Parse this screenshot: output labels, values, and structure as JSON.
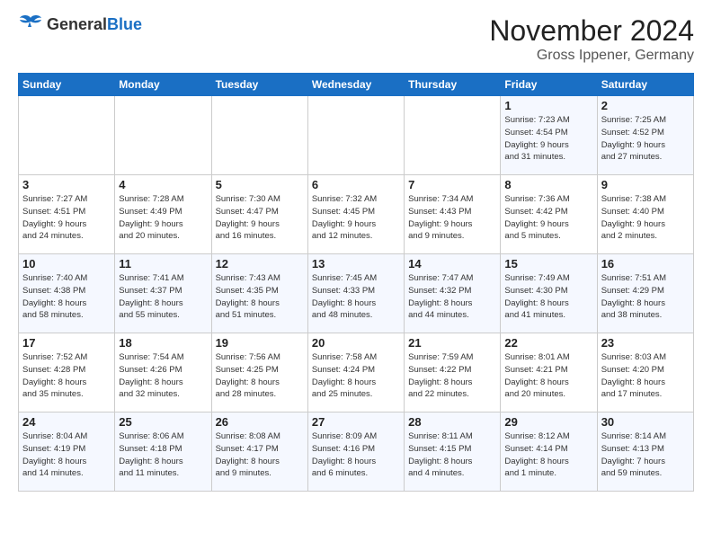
{
  "header": {
    "logo_general": "General",
    "logo_blue": "Blue",
    "month": "November 2024",
    "location": "Gross Ippener, Germany"
  },
  "weekdays": [
    "Sunday",
    "Monday",
    "Tuesday",
    "Wednesday",
    "Thursday",
    "Friday",
    "Saturday"
  ],
  "weeks": [
    [
      {
        "day": "",
        "info": ""
      },
      {
        "day": "",
        "info": ""
      },
      {
        "day": "",
        "info": ""
      },
      {
        "day": "",
        "info": ""
      },
      {
        "day": "",
        "info": ""
      },
      {
        "day": "1",
        "info": "Sunrise: 7:23 AM\nSunset: 4:54 PM\nDaylight: 9 hours\nand 31 minutes."
      },
      {
        "day": "2",
        "info": "Sunrise: 7:25 AM\nSunset: 4:52 PM\nDaylight: 9 hours\nand 27 minutes."
      }
    ],
    [
      {
        "day": "3",
        "info": "Sunrise: 7:27 AM\nSunset: 4:51 PM\nDaylight: 9 hours\nand 24 minutes."
      },
      {
        "day": "4",
        "info": "Sunrise: 7:28 AM\nSunset: 4:49 PM\nDaylight: 9 hours\nand 20 minutes."
      },
      {
        "day": "5",
        "info": "Sunrise: 7:30 AM\nSunset: 4:47 PM\nDaylight: 9 hours\nand 16 minutes."
      },
      {
        "day": "6",
        "info": "Sunrise: 7:32 AM\nSunset: 4:45 PM\nDaylight: 9 hours\nand 12 minutes."
      },
      {
        "day": "7",
        "info": "Sunrise: 7:34 AM\nSunset: 4:43 PM\nDaylight: 9 hours\nand 9 minutes."
      },
      {
        "day": "8",
        "info": "Sunrise: 7:36 AM\nSunset: 4:42 PM\nDaylight: 9 hours\nand 5 minutes."
      },
      {
        "day": "9",
        "info": "Sunrise: 7:38 AM\nSunset: 4:40 PM\nDaylight: 9 hours\nand 2 minutes."
      }
    ],
    [
      {
        "day": "10",
        "info": "Sunrise: 7:40 AM\nSunset: 4:38 PM\nDaylight: 8 hours\nand 58 minutes."
      },
      {
        "day": "11",
        "info": "Sunrise: 7:41 AM\nSunset: 4:37 PM\nDaylight: 8 hours\nand 55 minutes."
      },
      {
        "day": "12",
        "info": "Sunrise: 7:43 AM\nSunset: 4:35 PM\nDaylight: 8 hours\nand 51 minutes."
      },
      {
        "day": "13",
        "info": "Sunrise: 7:45 AM\nSunset: 4:33 PM\nDaylight: 8 hours\nand 48 minutes."
      },
      {
        "day": "14",
        "info": "Sunrise: 7:47 AM\nSunset: 4:32 PM\nDaylight: 8 hours\nand 44 minutes."
      },
      {
        "day": "15",
        "info": "Sunrise: 7:49 AM\nSunset: 4:30 PM\nDaylight: 8 hours\nand 41 minutes."
      },
      {
        "day": "16",
        "info": "Sunrise: 7:51 AM\nSunset: 4:29 PM\nDaylight: 8 hours\nand 38 minutes."
      }
    ],
    [
      {
        "day": "17",
        "info": "Sunrise: 7:52 AM\nSunset: 4:28 PM\nDaylight: 8 hours\nand 35 minutes."
      },
      {
        "day": "18",
        "info": "Sunrise: 7:54 AM\nSunset: 4:26 PM\nDaylight: 8 hours\nand 32 minutes."
      },
      {
        "day": "19",
        "info": "Sunrise: 7:56 AM\nSunset: 4:25 PM\nDaylight: 8 hours\nand 28 minutes."
      },
      {
        "day": "20",
        "info": "Sunrise: 7:58 AM\nSunset: 4:24 PM\nDaylight: 8 hours\nand 25 minutes."
      },
      {
        "day": "21",
        "info": "Sunrise: 7:59 AM\nSunset: 4:22 PM\nDaylight: 8 hours\nand 22 minutes."
      },
      {
        "day": "22",
        "info": "Sunrise: 8:01 AM\nSunset: 4:21 PM\nDaylight: 8 hours\nand 20 minutes."
      },
      {
        "day": "23",
        "info": "Sunrise: 8:03 AM\nSunset: 4:20 PM\nDaylight: 8 hours\nand 17 minutes."
      }
    ],
    [
      {
        "day": "24",
        "info": "Sunrise: 8:04 AM\nSunset: 4:19 PM\nDaylight: 8 hours\nand 14 minutes."
      },
      {
        "day": "25",
        "info": "Sunrise: 8:06 AM\nSunset: 4:18 PM\nDaylight: 8 hours\nand 11 minutes."
      },
      {
        "day": "26",
        "info": "Sunrise: 8:08 AM\nSunset: 4:17 PM\nDaylight: 8 hours\nand 9 minutes."
      },
      {
        "day": "27",
        "info": "Sunrise: 8:09 AM\nSunset: 4:16 PM\nDaylight: 8 hours\nand 6 minutes."
      },
      {
        "day": "28",
        "info": "Sunrise: 8:11 AM\nSunset: 4:15 PM\nDaylight: 8 hours\nand 4 minutes."
      },
      {
        "day": "29",
        "info": "Sunrise: 8:12 AM\nSunset: 4:14 PM\nDaylight: 8 hours\nand 1 minute."
      },
      {
        "day": "30",
        "info": "Sunrise: 8:14 AM\nSunset: 4:13 PM\nDaylight: 7 hours\nand 59 minutes."
      }
    ]
  ]
}
